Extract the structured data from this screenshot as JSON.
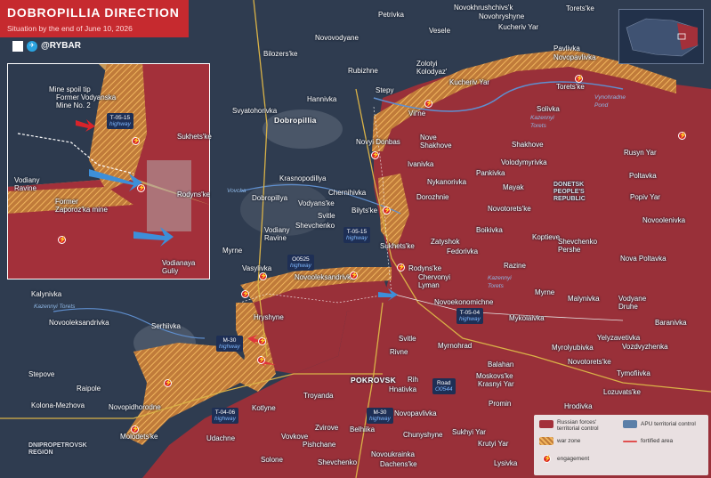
{
  "header": {
    "title": "DOBROPILLIA DIRECTION",
    "subtitle": "Situation by the end of June 10, 2026",
    "brand": "@RYBAR"
  },
  "colors": {
    "russian_control": "#a3303a",
    "contested_zone": "#e0a040",
    "apu_control": "#38485f",
    "engagement": "#d8232a",
    "highway_badge": "#1e2f55"
  },
  "settlements": {
    "petrivka": "Petrivka",
    "novohryshyne": "Novohryshyne",
    "novokhrushchivs": "Novokhrushchivs'k",
    "torets": "Torets'ke",
    "novovodyane": "Novovodyane",
    "bilozerske": "Bilozers'ke",
    "vesele": "Vesele",
    "zolotyi": "Zolotyi\nKolodyaz'",
    "kucheriv_yar": "Kucheriv Yar",
    "rubizhne": "Rubizhne",
    "pavlivka": "Pavlivka",
    "novopavlivka_n": "Novopavlivka",
    "torets_ke2": "Torets'ke",
    "hannivka": "Hannivka",
    "stepy": "Stepy",
    "sviatohorivka": "Svyatohorivka",
    "dobropillia": "Dobropillia",
    "solivka": "Solivka",
    "vilne": "Vil'ne",
    "novyi_donbas": "Novyi Donbas",
    "nove_shakhove": "Nove\nShakhove",
    "shakhove": "Shakhove",
    "rusyn_yar": "Rusyn Yar",
    "ivanivka": "Ivanivka",
    "volodymyrivka": "Volodymyrivka",
    "poltavka": "Poltavka",
    "pankivka": "Pankivka",
    "nykanorivka": "Nykanorivka",
    "mayak": "Mayak",
    "krasnopodillya": "Krasnopodillya",
    "chernihivka": "Chernihivka",
    "dorozhnie": "Dorozhnie",
    "novotorets": "Novotorets'ke",
    "popiv_yar": "Popiv Yar",
    "vodyans_ke": "Vodyans'ke",
    "dobropillya2": "Dobropillya",
    "svitle_n": "Svitle",
    "bilyts_ke": "Bilyts'ke",
    "novoolenivka": "Novoolenivka",
    "boikivka": "Boikivka",
    "koptieve": "Koptieve",
    "shevchenko_pershe": "Shevchenko\nPershe",
    "vodiany_ravine": "Vodiany\nRavine",
    "shevchenko": "Shevchenko",
    "sukhets_ke2": "Sukhets'ke",
    "zatyshok": "Zatyshok",
    "fedorivka": "Fedorivka",
    "myrne": "Myrne",
    "vasylivka": "Vasylivka",
    "nova_poltavka": "Nova Poltavka",
    "razine": "Razine",
    "rodyns_ke2": "Rodyns'ke",
    "chervonyi_lyman": "Chervonyi\nLyman",
    "novooleksandrivka_c": "Novooleksandrivka",
    "kalynivka": "Kalynivka",
    "myrne2": "Myrne",
    "malynivka": "Malynivka",
    "vodyane_druhe": "Vodyane\nDruhe",
    "baranivka": "Baranivka",
    "novoekonomichne": "Novoekonomichne",
    "hryshyne": "Hryshyne",
    "mykolaivka": "Mykolaivka",
    "novooleksandrivka_w": "Novooleksandrivka",
    "serhiivka": "Serhiivka",
    "svitle_s": "Svitle",
    "myrnohrad": "Myrnohrad",
    "yelyzavetivka": "Yelyzavetivka",
    "myrolyubivka": "Myrolyubivka",
    "vozdvyzhenka": "Vozdvyzhenka",
    "stepove": "Stepove",
    "rivne": "Rivne",
    "balahan": "Balahan",
    "novotorets2": "Novotorets'ke",
    "tymofiivka": "Tymofiivka",
    "pokrovsk": "POKROVSK",
    "rih": "Rih",
    "moskovs_ke": "Moskovs'ke",
    "krasnyi_yar": "Krasnyi Yar",
    "raipole": "Raipole",
    "troyanda": "Troyanda",
    "hnativka": "Hnativka",
    "lozuvats_ke": "Lozuvats'ke",
    "kolona_mezhova": "Kolona-Mezhova",
    "novopidhorodne": "Novopidhorodne",
    "kotlyne": "Kotlyne",
    "promin": "Promin",
    "hrodivka": "Hrodivka",
    "novopavlivka_s": "Novopavlivka",
    "zvirove": "Zvirove",
    "belhiika": "Belhiika",
    "chunyshyne": "Chunyshyne",
    "sukhyi_yar": "Sukhyi Yar",
    "krutyi_yar": "Krutyi Yar",
    "molodetske": "Molodets'ke",
    "udachne": "Udachne",
    "vovkove": "Vovkove",
    "pishchane": "Pishchane",
    "solone": "Solone",
    "shevchenko_s": "Shevchenko",
    "novoukrainka": "Novoukrainka",
    "dachens_ke": "Dachens'ke",
    "lysivka": "Lysivka",
    "sukhets_ke1": "Sukhets'ke",
    "rodyns_ke1": "Rodyns'ke"
  },
  "region_labels": {
    "donetsk": "DONETSK\nPEOPLE'S\nREPUBLIC",
    "dnipropetrovsk": "DNIPROPETROVSK\nREGION"
  },
  "water_labels": {
    "vovcha": "Vovcha",
    "kazennyi_torets": "Kazennyi\nTorets",
    "vynohradne_pond": "Vynohradne\nPond",
    "kazennyi_torets2": "Kazennyi\nTorets",
    "kazennyi_torets3": "Kazennyi\nTorets"
  },
  "highways": {
    "t0515_n": {
      "code": "T-05-15",
      "sub": "highway"
    },
    "t0515_c": {
      "code": "T-05-15",
      "sub": "highway"
    },
    "o0525": {
      "code": "O0525",
      "sub": "highway"
    },
    "t0504": {
      "code": "T-05-04",
      "sub": "highway"
    },
    "m30_w": {
      "code": "M-30",
      "sub": "highway"
    },
    "m30_s": {
      "code": "M-30",
      "sub": "highway"
    },
    "t0406": {
      "code": "T-04-06",
      "sub": "highway"
    },
    "road_o0544": {
      "code": "Road",
      "sub": "O0544"
    }
  },
  "inset": {
    "mine_spoil_tip": "Mine spoil tip",
    "former_mine": "Former Vodyanska\nMine No. 2",
    "former_zaporoz": "Former\nZaporoz'ka mine",
    "vodiany_ravine": "Vodiany\nRavine",
    "vodianaya_guly": "Vodianaya\nGuliy"
  },
  "legend": {
    "russian_forces": "Russian forces'\nterritorial control",
    "apu_control": "APU territorial control",
    "war_zone": "war zone",
    "fortified_area": "fortified area",
    "engagement": "engagement"
  }
}
